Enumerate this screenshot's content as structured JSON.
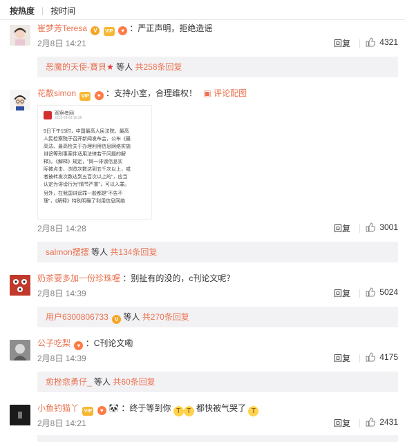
{
  "sort": {
    "by_heat": "按热度",
    "by_time": "按时间"
  },
  "comments": [
    {
      "user": "崔梦芳Teresa",
      "text": "：严正声明，拒绝造谣",
      "date": "2月8日 14:21",
      "reply": "回复",
      "likes": "4321",
      "replies": {
        "who": "恶魔的天使-寶貝",
        "suffix": "等人",
        "count": "共258条回复"
      }
    },
    {
      "user": "花散simon",
      "text": "：支持小室，合理维权！",
      "pic_link": "评论配图",
      "date": "2月8日 14:28",
      "reply": "回复",
      "likes": "3001",
      "replies": {
        "who": "salmon摆摆",
        "suffix": "等人",
        "count": "共134条回复"
      },
      "image": {
        "source": "观察者网",
        "source_date": "2013-09-09 16:36",
        "para1": "9日下午15时，中国最高人民法院、最高\n人民检察院于召开新闻发布会，公布《最\n高法、最高检关于办理利用信息网络实施\n诽谤等刑事案件适用法律若干问题的解\n释》。《解释》规定，\"同一诽谤信息实\n际被点击、浏览次数达到五千次以上，或\n者被转发次数达到五百次以上的\"，应当\n认定为诽谤行为\"情节严重\"，可以入罪。",
        "para2": "另外，在我国诽谤罪一般都是\"不告不\n理\"，《解释》特别明确了利用信息网络"
      }
    },
    {
      "user": "奶茶要多加一份珍珠喔",
      "text": "：别扯有的没的，c刊论文呢？",
      "date": "2月8日 14:39",
      "reply": "回复",
      "likes": "5024",
      "replies": {
        "who": "用户6300806733",
        "suffix": "等人",
        "count": "共270条回复"
      }
    },
    {
      "user": "公子吃梨",
      "text": "：C刊论文嘞",
      "date": "2月8日 14:39",
      "reply": "回复",
      "likes": "4175",
      "replies": {
        "who": "愈挫愈勇仔_",
        "suffix": "等人",
        "count": "共60条回复"
      }
    },
    {
      "user": "小鱼钓猫丫",
      "text1": "：终于等到你",
      "text2": "都快被气哭了",
      "date": "2月8日 14:21",
      "reply": "回复",
      "likes": "2431"
    }
  ]
}
